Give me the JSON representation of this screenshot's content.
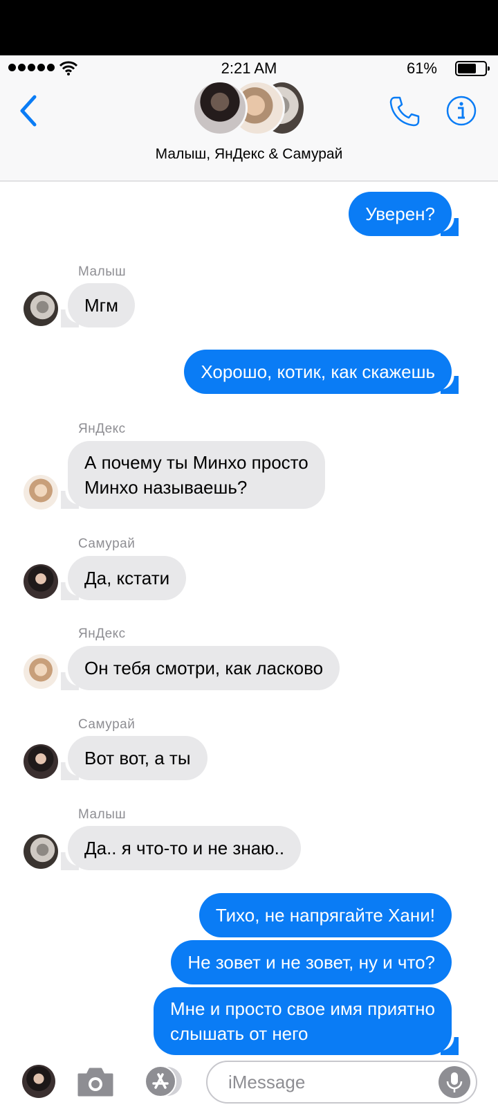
{
  "status_bar": {
    "time": "2:21 AM",
    "battery_pct": "61%"
  },
  "header": {
    "group_name": "Малыш, ЯнДекс & Самурай"
  },
  "messages": [
    {
      "dir": "out",
      "text": "Уверен?"
    },
    {
      "dir": "in",
      "sender": "Малыш",
      "text": "Мгм"
    },
    {
      "dir": "out",
      "text": "Хорошо, котик, как скажешь"
    },
    {
      "dir": "in",
      "sender": "ЯнДекс",
      "lines": [
        "А почему ты Минхо просто",
        "Минхо называешь?"
      ]
    },
    {
      "dir": "in",
      "sender": "Самурай",
      "text": "Да, кстати"
    },
    {
      "dir": "in",
      "sender": "ЯнДекс",
      "text": "Он тебя смотри, как ласково"
    },
    {
      "dir": "in",
      "sender": "Самурай",
      "text": "Вот вот, а ты"
    },
    {
      "dir": "in",
      "sender": "Малыш",
      "text": "Да.. я что-то и не знаю.."
    },
    {
      "dir": "out",
      "text": "Тихо, не напрягайте Хани!"
    },
    {
      "dir": "out",
      "text": "Не зовет и не зовет, ну и что?"
    },
    {
      "dir": "out",
      "lines": [
        "Мне и просто свое имя приятно",
        "слышать от него"
      ]
    }
  ],
  "composer": {
    "placeholder": "iMessage"
  },
  "colors": {
    "accent": "#0a7cf5",
    "incoming_bubble": "#e8e8ea",
    "sender_label": "#8e8e93"
  },
  "icons": [
    "back-chevron-icon",
    "phone-icon",
    "info-icon",
    "camera-icon",
    "app-store-icon",
    "microphone-icon",
    "wifi-icon",
    "battery-icon"
  ]
}
